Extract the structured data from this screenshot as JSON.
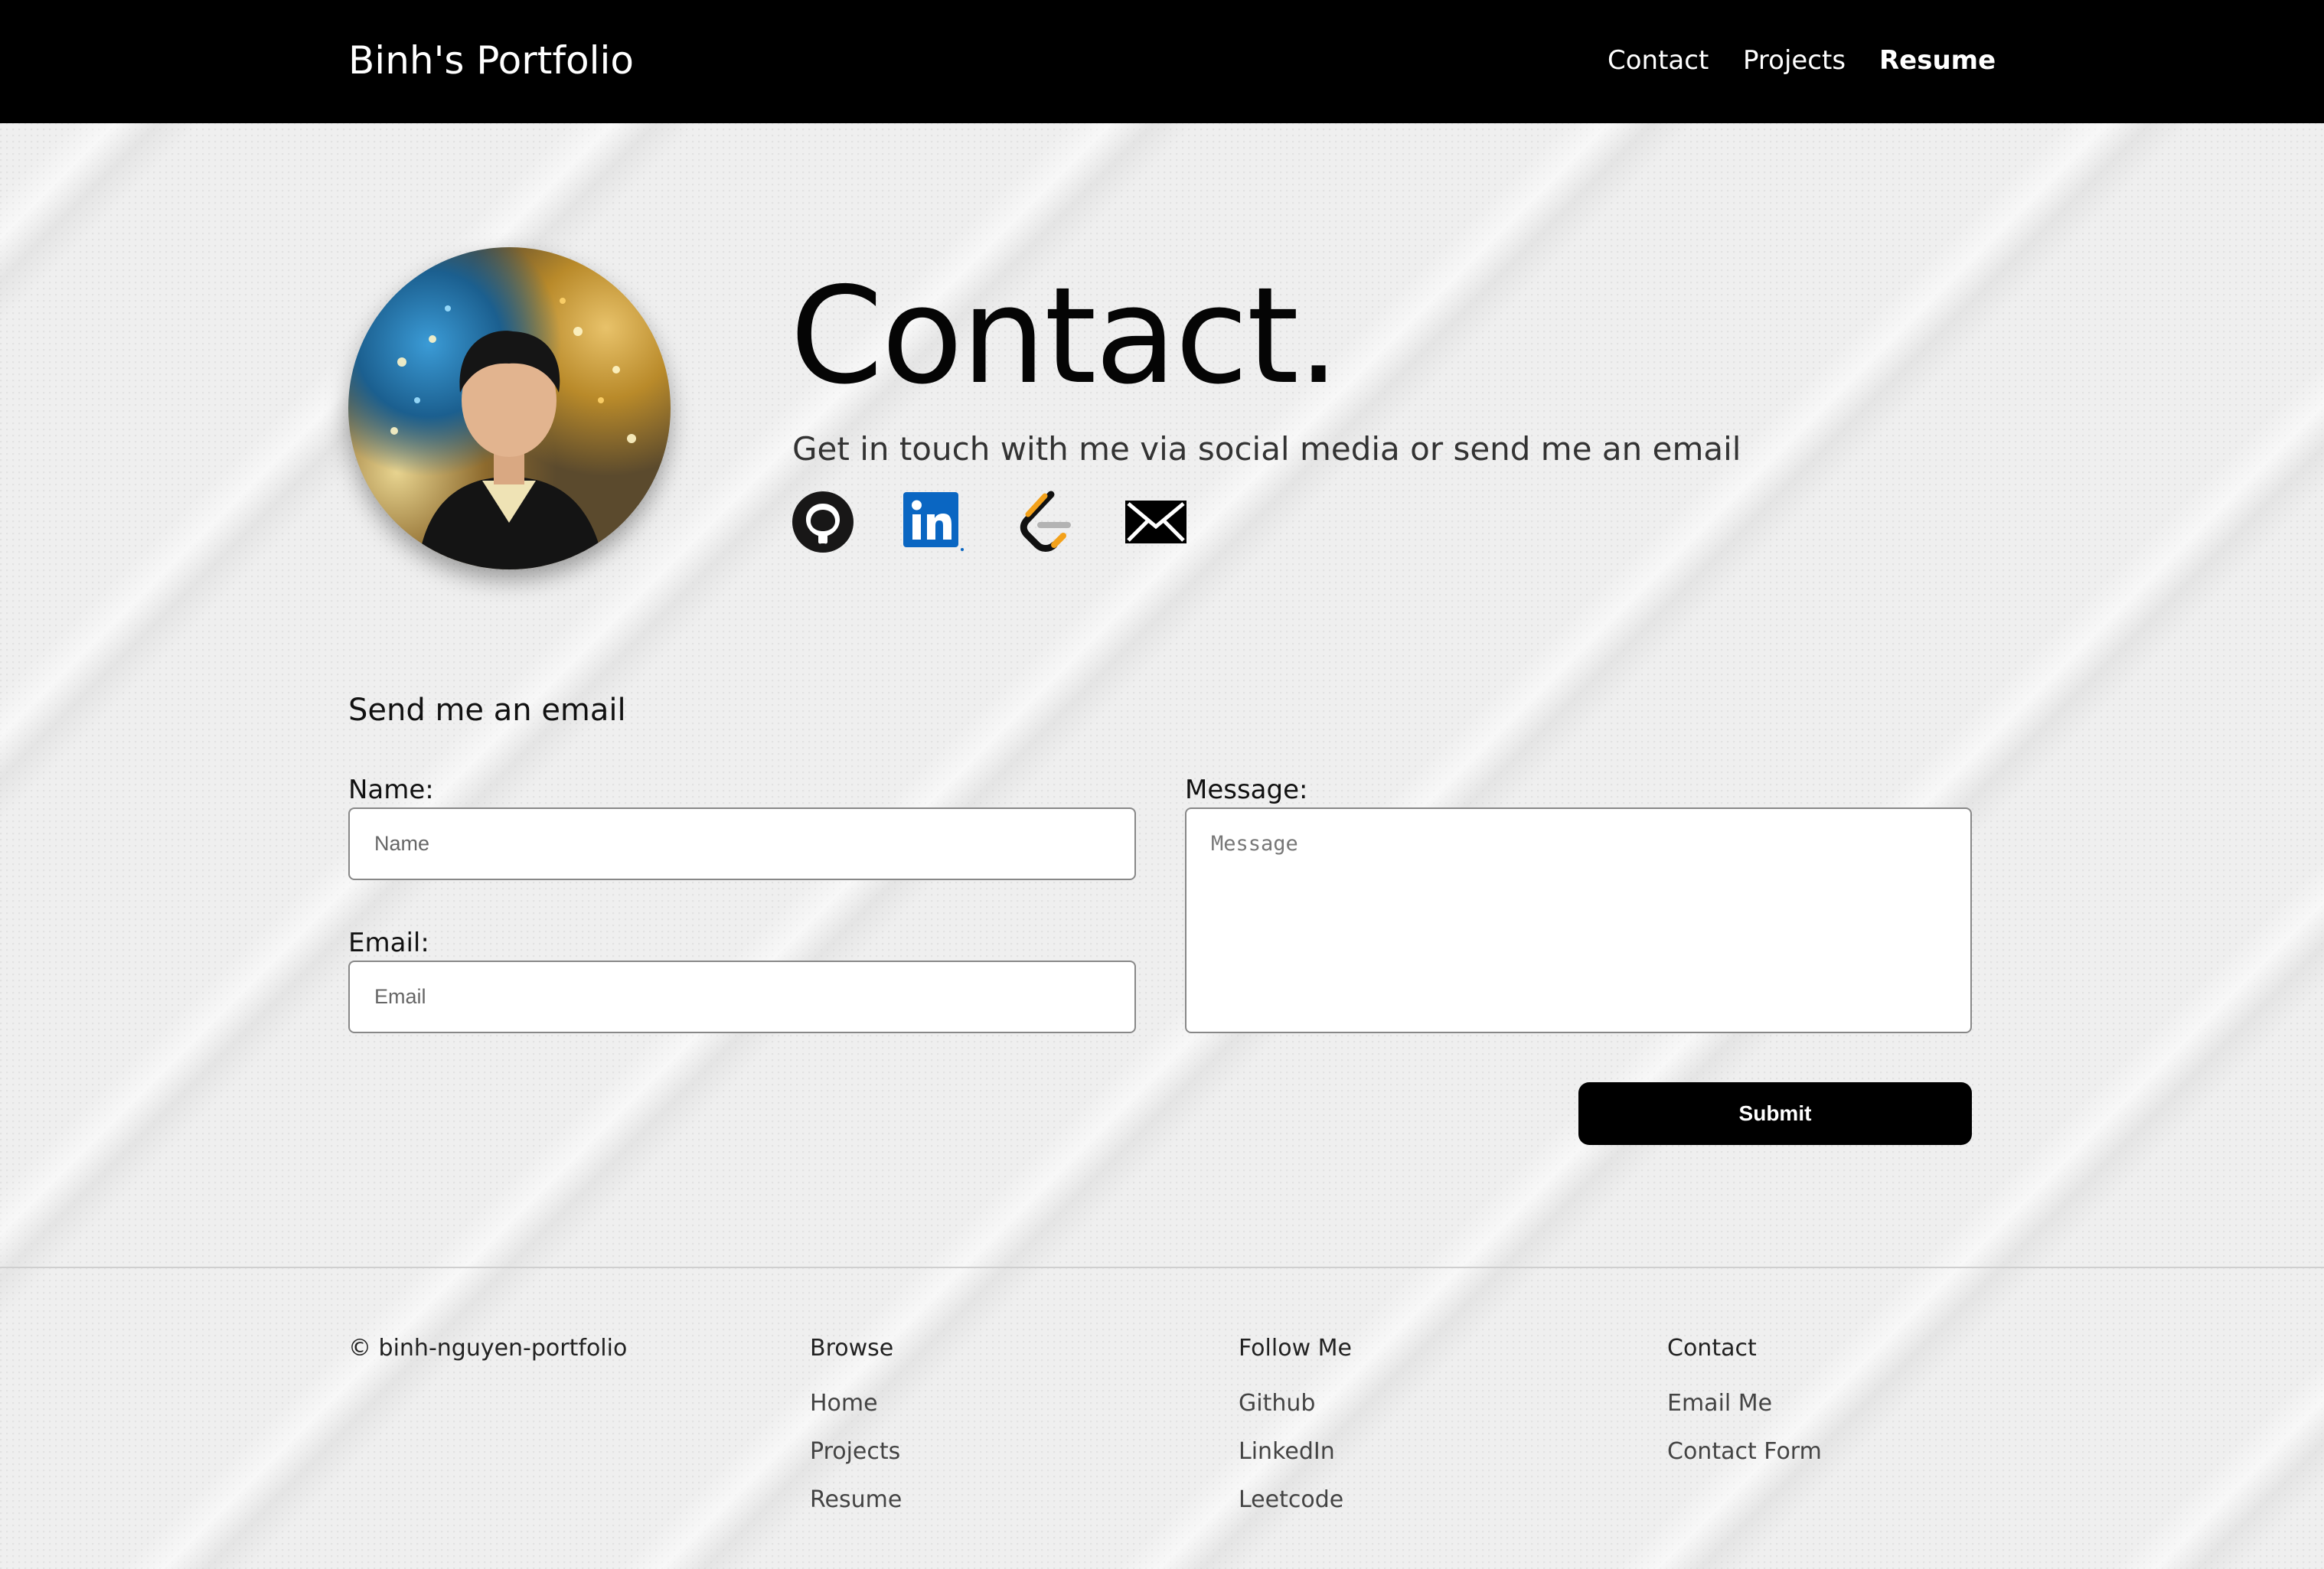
{
  "nav": {
    "brand": "Binh's Portfolio",
    "links": [
      "Contact",
      "Projects",
      "Resume"
    ]
  },
  "hero": {
    "title": "Contact.",
    "subtitle": "Get in touch with me via social media or send me an email",
    "social_icons": [
      "github-icon",
      "linkedin-icon",
      "leetcode-icon",
      "envelope-icon"
    ]
  },
  "form": {
    "heading": "Send me an email",
    "name_label": "Name:",
    "name_placeholder": "Name",
    "email_label": "Email:",
    "email_placeholder": "Email",
    "message_label": "Message:",
    "message_placeholder": "Message",
    "submit_label": "Submit"
  },
  "footer": {
    "copyright": "© binh-nguyen-portfolio",
    "columns": [
      {
        "title": "Browse",
        "items": [
          "Home",
          "Projects",
          "Resume"
        ]
      },
      {
        "title": "Follow Me",
        "items": [
          "Github",
          "LinkedIn",
          "Leetcode"
        ]
      },
      {
        "title": "Contact",
        "items": [
          "Email Me",
          "Contact Form"
        ]
      }
    ]
  },
  "colors": {
    "nav_bg": "#000000",
    "page_bg": "#efefef",
    "button_bg": "#000000",
    "linkedin_blue": "#0a66c2",
    "leetcode_orange": "#f3a11a"
  }
}
